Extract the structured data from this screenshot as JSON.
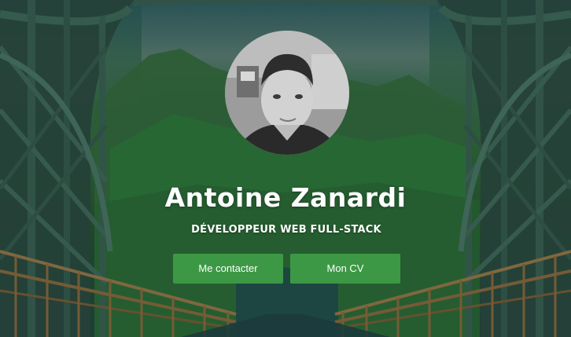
{
  "profile": {
    "name": "Antoine Zanardi",
    "title": "DÉVELOPPEUR WEB FULL-STACK"
  },
  "actions": {
    "contact_label": "Me contacter",
    "cv_label": "Mon CV"
  },
  "colors": {
    "button": "#3c9845",
    "text": "#ffffff"
  }
}
